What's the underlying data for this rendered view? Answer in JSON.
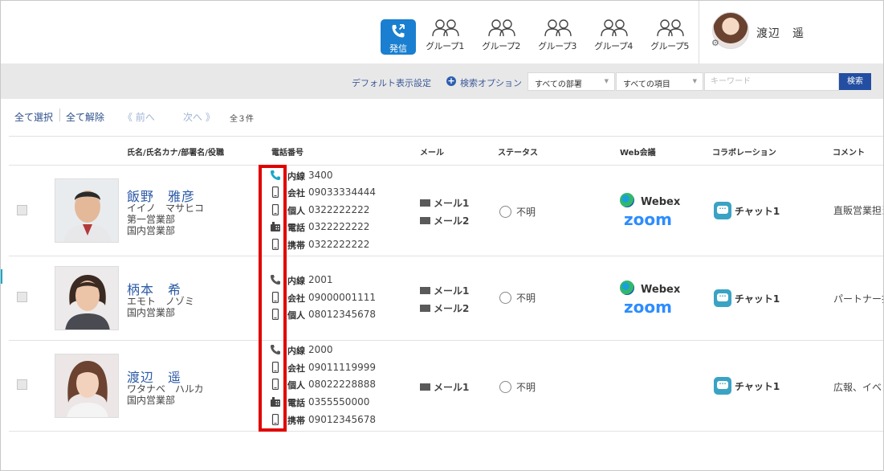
{
  "header": {
    "call_label": "発信",
    "groups": [
      "グループ1",
      "グループ2",
      "グループ3",
      "グループ4",
      "グループ5"
    ],
    "user_name": "渡辺　遥"
  },
  "search": {
    "default_display": "デフォルト表示設定",
    "search_option": "検索オプション",
    "dept_select": "すべての部署",
    "item_select": "すべての項目",
    "keyword_placeholder": "キーワード",
    "search_button": "検索"
  },
  "toolbar": {
    "select_all": "全て選択",
    "deselect_all": "全て解除",
    "prev": "《 前へ",
    "next": "次へ 》",
    "count": "全３件"
  },
  "columns": {
    "name": "氏名/氏名カナ/部署名/役職",
    "phone": "電話番号",
    "mail": "メール",
    "status": "ステータス",
    "web": "Web会議",
    "collab": "コラボレーション",
    "comment": "コメント"
  },
  "rows": [
    {
      "name": "飯野　雅彦",
      "kana": "イイノ　マサヒコ",
      "dept1": "第一営業部",
      "dept2": "国内営業部",
      "phones": [
        {
          "kind": "内線",
          "number": "3400"
        },
        {
          "kind": "会社",
          "number": "09033334444"
        },
        {
          "kind": "個人",
          "number": "0322222222"
        },
        {
          "kind": "電話",
          "number": "0322222222"
        },
        {
          "kind": "携帯",
          "number": "0322222222"
        }
      ],
      "mails": [
        "メール1",
        "メール2"
      ],
      "status": "不明",
      "webex": "Webex",
      "zoom": "zoom",
      "chat": "チャット1",
      "comment": "直販営業担当"
    },
    {
      "name": "柄本　希",
      "kana": "エモト　ノゾミ",
      "dept1": "国内営業部",
      "phones": [
        {
          "kind": "内線",
          "number": "2001"
        },
        {
          "kind": "会社",
          "number": "09000001111"
        },
        {
          "kind": "個人",
          "number": "08012345678"
        }
      ],
      "mails": [
        "メール1",
        "メール2"
      ],
      "status": "不明",
      "webex": "Webex",
      "zoom": "zoom",
      "chat": "チャット1",
      "comment": "パートナー担"
    },
    {
      "name": "渡辺　遥",
      "kana": "ワタナベ　ハルカ",
      "dept1": "国内営業部",
      "phones": [
        {
          "kind": "内線",
          "number": "2000"
        },
        {
          "kind": "会社",
          "number": "09011119999"
        },
        {
          "kind": "個人",
          "number": "08022228888"
        },
        {
          "kind": "電話",
          "number": "0355550000"
        },
        {
          "kind": "携帯",
          "number": "09012345678"
        }
      ],
      "mails": [
        "メール1"
      ],
      "status": "不明",
      "chat": "チャット1",
      "comment": "広報、イベン"
    }
  ],
  "colors": {
    "accent": "#1a7fd0",
    "link": "#2c5aa6",
    "search_button": "#234ea1",
    "highlight": "#e00000",
    "zoom": "#2d8cff",
    "chat": "#3aa3c4"
  }
}
